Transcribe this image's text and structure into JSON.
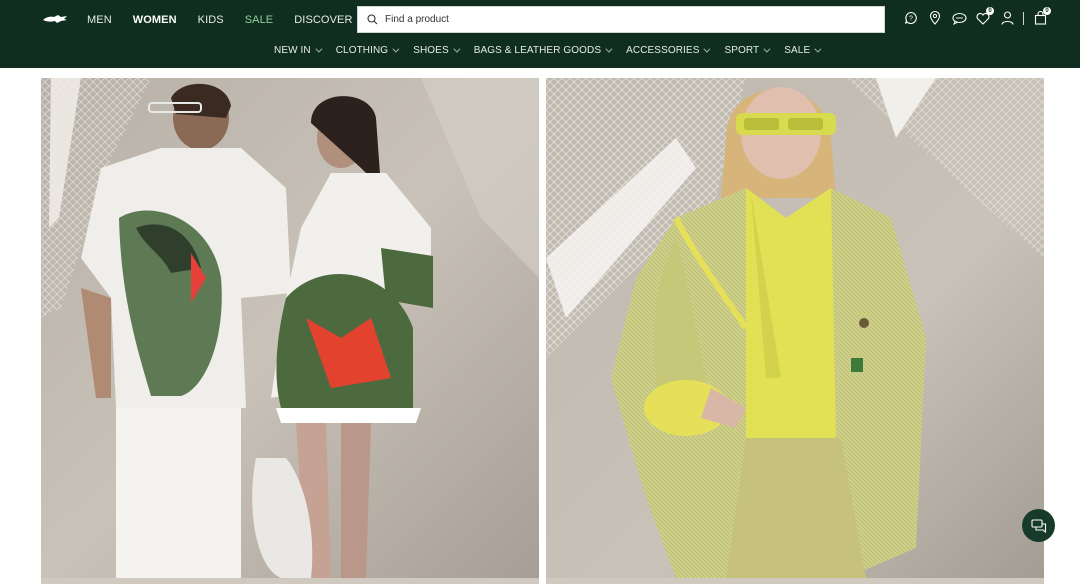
{
  "brand": {
    "logo_icon": "crocodile-logo-icon"
  },
  "topnav": {
    "items": [
      {
        "label": "MEN"
      },
      {
        "label": "WOMEN"
      },
      {
        "label": "KIDS"
      },
      {
        "label": "SALE"
      },
      {
        "label": "DISCOVER"
      }
    ],
    "active": "WOMEN"
  },
  "search": {
    "placeholder": "Find a product",
    "icon": "search-icon"
  },
  "header_icons": {
    "items": [
      "help-icon",
      "store-locator-icon",
      "chat-bubbles-icon",
      "wishlist-heart-icon",
      "account-icon",
      "cart-icon"
    ],
    "wishlist_count": "0",
    "cart_count": "0"
  },
  "categories": {
    "items": [
      {
        "label": "NEW IN"
      },
      {
        "label": "CLOTHING"
      },
      {
        "label": "SHOES"
      },
      {
        "label": "BAGS & LEATHER GOODS"
      },
      {
        "label": "ACCESSORIES"
      },
      {
        "label": "SPORT"
      },
      {
        "label": "SALE"
      }
    ]
  },
  "colors": {
    "header_bg": "#0f2e1f",
    "sale_green": "#8fd19e",
    "chat_button": "#163b2a"
  },
  "chat_button": {
    "icon": "chat-support-icon"
  }
}
